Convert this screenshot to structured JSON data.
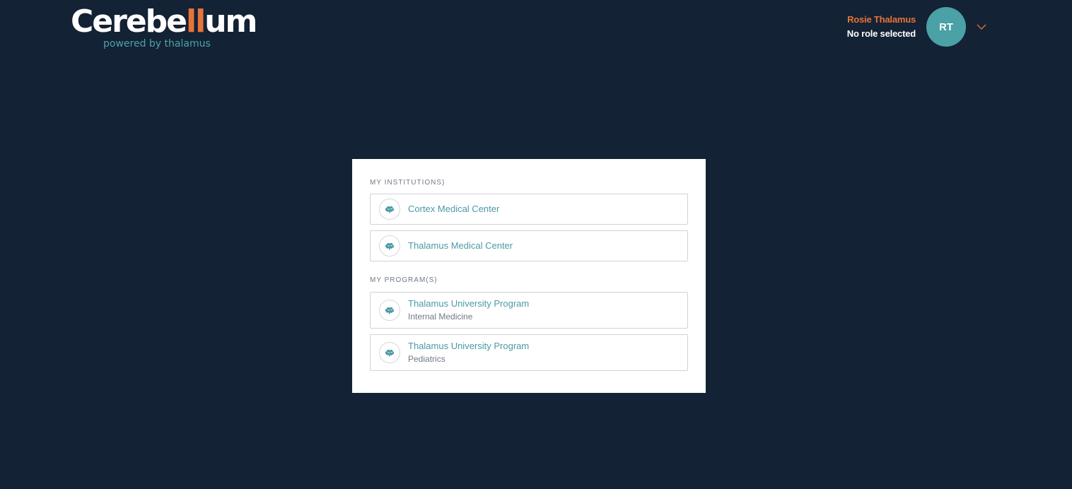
{
  "brand": {
    "name_part1": "Cerebe",
    "name_accent": "ll",
    "name_part2": "um",
    "tagline": "powered by thalamus",
    "accent_color": "#e8733a",
    "tagline_color": "#4ba3ad"
  },
  "header": {
    "user_name": "Rosie Thalamus",
    "user_role": "No role selected",
    "avatar_initials": "RT",
    "dropdown_icon": "chevron-down-icon"
  },
  "institutions": {
    "label": "MY INSTITUTIONS)",
    "items": [
      {
        "title": "Cortex Medical Center",
        "icon": "brain-icon"
      },
      {
        "title": "Thalamus Medical Center",
        "icon": "brain-icon"
      }
    ]
  },
  "programs": {
    "label": "MY PROGRAM(S)",
    "items": [
      {
        "title": "Thalamus University Program",
        "subtitle": "Internal Medicine",
        "icon": "brain-icon"
      },
      {
        "title": "Thalamus University Program",
        "subtitle": "Pediatrics",
        "icon": "brain-icon"
      }
    ]
  },
  "colors": {
    "background": "#132234",
    "avatar": "#4aa1a6",
    "link": "#4a9aa5"
  }
}
